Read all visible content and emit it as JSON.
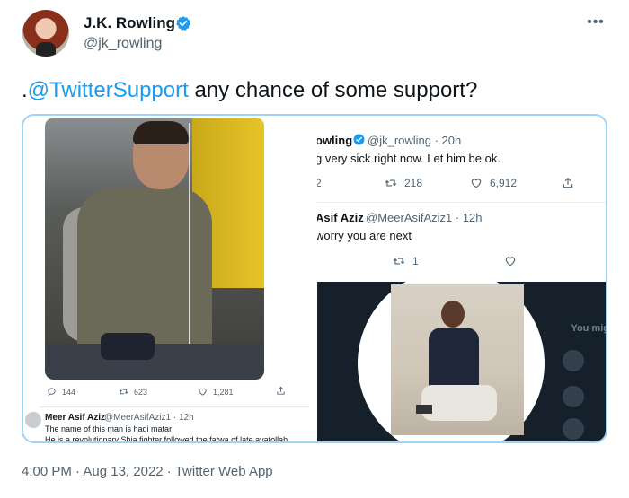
{
  "author": {
    "display_name": "J.K. Rowling",
    "handle": "@jk_rowling"
  },
  "tweet": {
    "prefix": ".",
    "mention": "@TwitterSupport",
    "text": " any chance of some support?"
  },
  "left_screenshot": {
    "actions": {
      "replies": "144",
      "retweets": "623",
      "likes": "1,281"
    },
    "reply": {
      "name": "Meer Asif Aziz",
      "handle": "@MeerAsifAziz1 · 12h",
      "line1": "The name of this man is hadi matar",
      "line2": "He is a revolutionary Shia fighter followed the fatwa of late ayatollah"
    }
  },
  "right_screenshot": {
    "tweet1": {
      "name": "owling",
      "handle": "@jk_rowling · 20h",
      "text": "g very sick right now. Let him be ok.",
      "replies": "2",
      "retweets": "218",
      "likes": "6,912"
    },
    "tweet2": {
      "name": "Asif Aziz",
      "handle": "@MeerAsifAziz1 · 12h",
      "text": "worry you are next",
      "retweets": "1"
    },
    "sidebar_text": "You mig"
  },
  "footer": {
    "time": "4:00 PM",
    "date": "Aug 13, 2022",
    "source": "Twitter Web App"
  },
  "colors": {
    "accent": "#1d9bf0",
    "secondary_text": "#536471",
    "media_border": "#9fd3f7",
    "dark_panel": "#15202b"
  },
  "icons": [
    "verified-badge-icon",
    "more-options-icon",
    "reply-icon",
    "retweet-icon",
    "like-icon",
    "share-icon"
  ]
}
